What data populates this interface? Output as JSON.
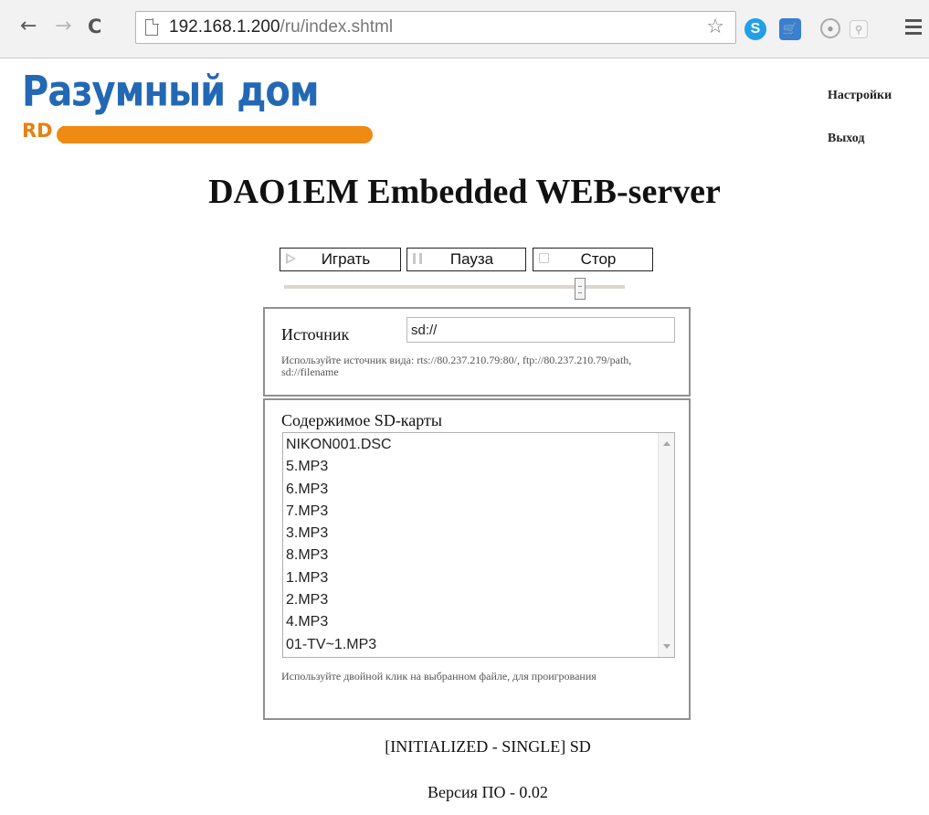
{
  "browser": {
    "url_host": "192.168.1.200",
    "url_path": "/ru/index.shtml",
    "icons": [
      "back-arrow-icon",
      "forward-arrow-icon",
      "reload-icon",
      "page-icon",
      "star-icon",
      "skype-icon",
      "cart-icon",
      "record-icon",
      "search-icon",
      "menu-icon"
    ]
  },
  "logo": {
    "title": "Разумный дом",
    "brand": "RD",
    "colors": {
      "title": "#2368b4",
      "bar": "#ef8a13"
    }
  },
  "nav": {
    "settings": "Настройки",
    "exit": "Выход"
  },
  "heading": "DAO1EM Embedded WEB-server",
  "controls": {
    "play": "Играть",
    "pause": "Пауза",
    "stop": "Стор",
    "volume_fraction": 0.88
  },
  "source": {
    "label": "Источник",
    "value": "sd://",
    "hint": "Используйте источник вида: rts://80.237.210.79:80/, ftp://80.237.210.79/path, sd://filename"
  },
  "sd": {
    "label": "Содержимое SD-карты",
    "files": [
      "NIKON001.DSC",
      "5.MP3",
      "6.MP3",
      "7.MP3",
      "3.MP3",
      "8.MP3",
      "1.MP3",
      "2.MP3",
      "4.MP3",
      "01-TV~1.MP3"
    ],
    "hint": "Используйте двойной клик на выбранном файле, для проигрования"
  },
  "status": "[INITIALIZED - SINGLE] SD",
  "version": "Версия ПО - 0.02"
}
